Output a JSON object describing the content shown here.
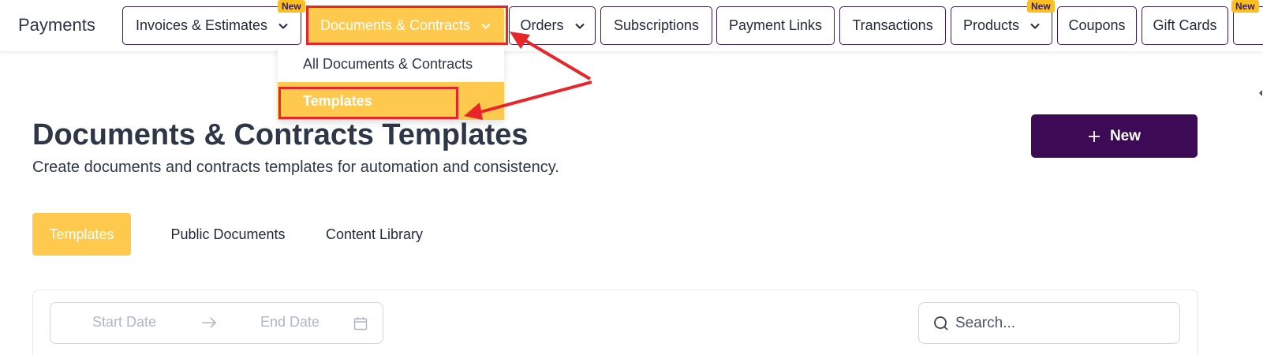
{
  "header": {
    "app_title": "Payments",
    "nav": [
      {
        "label": "Invoices & Estimates",
        "badge": "New",
        "dropdown": true
      },
      {
        "label": "Documents & Contracts",
        "badge": "",
        "dropdown": true,
        "active": true
      },
      {
        "label": "Orders",
        "badge": "",
        "dropdown": true
      },
      {
        "label": "Subscriptions",
        "badge": "",
        "dropdown": false
      },
      {
        "label": "Payment Links",
        "badge": "",
        "dropdown": false
      },
      {
        "label": "Transactions",
        "badge": "",
        "dropdown": false
      },
      {
        "label": "Products",
        "badge": "New",
        "dropdown": true
      },
      {
        "label": "Coupons",
        "badge": "",
        "dropdown": false
      },
      {
        "label": "Gift Cards",
        "badge": "",
        "dropdown": false
      },
      {
        "label": "",
        "badge": "New",
        "dropdown": false
      }
    ]
  },
  "dropdown": {
    "items": [
      {
        "label": "All Documents & Contracts",
        "selected": false
      },
      {
        "label": "Templates",
        "selected": true
      }
    ]
  },
  "page": {
    "title": "Documents & Contracts Templates",
    "subtitle": "Create documents and contracts templates for automation and consistency.",
    "new_button_label": "New",
    "tabs": [
      "Templates",
      "Public Documents",
      "Content Library"
    ]
  },
  "filters": {
    "start_date_placeholder": "Start Date",
    "end_date_placeholder": "End Date",
    "search_placeholder": "Search..."
  },
  "colors": {
    "accent": "#ffc94d",
    "brand": "#3d0a55",
    "annotation": "#e8262a"
  }
}
